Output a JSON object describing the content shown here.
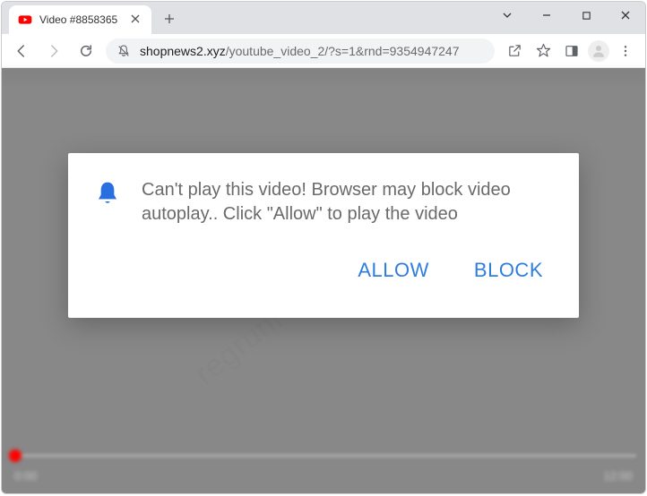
{
  "titlebar": {
    "tab_title": "Video #8858365"
  },
  "toolbar": {
    "url_domain": "shopnews2.xyz",
    "url_path": "/youtube_video_2/?s=1&rnd=9354947247"
  },
  "player": {
    "time_current": "0:00",
    "time_total": "12:00"
  },
  "modal": {
    "text": "Can't play this video! Browser may block video autoplay.. Click \"Allow\" to play the video",
    "allow_label": "ALLOW",
    "block_label": "BLOCK"
  },
  "watermark": "regrunreanimator.com"
}
